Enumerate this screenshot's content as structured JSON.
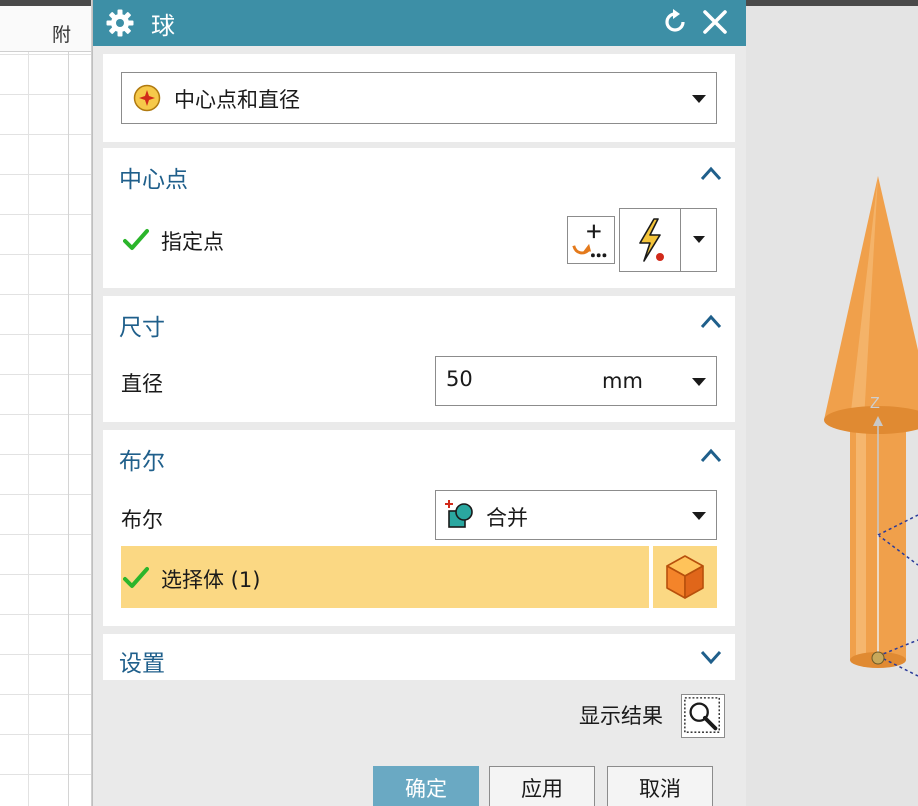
{
  "spreadsheet": {
    "column_letter": "附"
  },
  "dialog": {
    "title": "球",
    "icons": {
      "settings": "gear-icon",
      "reset": "reset-icon",
      "close": "close-icon"
    },
    "type_selector": {
      "value": "中心点和直径",
      "icon": "center-diameter-icon"
    },
    "sections": {
      "center": {
        "title": "中心点",
        "expanded": true,
        "specify_point_label": "指定点",
        "status": "complete"
      },
      "dimension": {
        "title": "尺寸",
        "expanded": true,
        "diameter_label": "直径",
        "diameter_value": "50",
        "diameter_unit": "mm"
      },
      "boolean": {
        "title": "布尔",
        "expanded": true,
        "boolean_label": "布尔",
        "boolean_value": "合并",
        "select_body_label": "选择体 (1)",
        "highlight_color": "#fbd883"
      },
      "settings": {
        "title": "设置",
        "expanded": false
      }
    },
    "show_result_label": "显示结果",
    "buttons": {
      "ok": "确定",
      "apply": "应用",
      "cancel": "取消"
    }
  },
  "viewport": {
    "axis_label": "Z",
    "model_color": "#f0a04b"
  },
  "colors": {
    "titlebar": "#3d8fa6",
    "section_title": "#1f5f8b",
    "ok_button": "#6aa9c3",
    "check_green": "#2bb52b"
  }
}
